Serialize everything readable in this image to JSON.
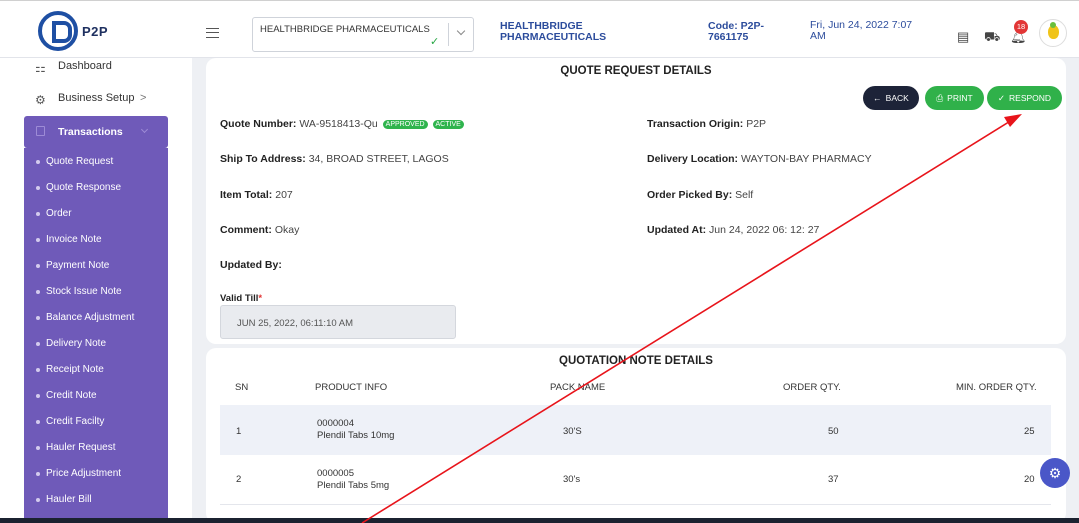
{
  "header": {
    "brand": "P2P",
    "company_select_value": "HEALTHBRIDGE PHARMACEUTICALS",
    "company_name": "HEALTHBRIDGE PHARMACEUTICALS",
    "code": "Code: P2P-7661175",
    "datetime": "Fri, Jun 24, 2022 7:07 AM",
    "notification_count": "18"
  },
  "sidebar": {
    "dashboard": "Dashboard",
    "business_setup": "Business Setup",
    "business_setup_chevron": ">",
    "transactions": "Transactions",
    "items": [
      "Quote Request",
      "Quote Response",
      "Order",
      "Invoice Note",
      "Payment Note",
      "Stock Issue Note",
      "Balance Adjustment",
      "Delivery Note",
      "Receipt Note",
      "Credit Note",
      "Credit Facilty",
      "Hauler Request",
      "Price Adjustment",
      "Hauler Bill"
    ]
  },
  "details": {
    "title": "QUOTE REQUEST DETAILS",
    "back_label": "BACK",
    "print_label": "PRINT",
    "respond_label": "RESPOND",
    "quote_number_label": "Quote Number:",
    "quote_number": "WA-9518413-Qu",
    "status_approved": "APPROVED",
    "status_active": "ACTIVE",
    "transaction_origin_label": "Transaction Origin:",
    "transaction_origin": "P2P",
    "ship_to_label": "Ship To Address:",
    "ship_to": "34, BROAD STREET, LAGOS",
    "delivery_location_label": "Delivery Location:",
    "delivery_location": "WAYTON-BAY PHARMACY",
    "item_total_label": "Item Total:",
    "item_total": "207",
    "order_picked_label": "Order Picked By:",
    "order_picked": "Self",
    "comment_label": "Comment:",
    "comment": "Okay",
    "updated_at_label": "Updated At:",
    "updated_at": "Jun 24, 2022 06: 12: 27",
    "updated_by_label": "Updated By:",
    "valid_till_label": "Valid Till",
    "valid_till_required": "*",
    "valid_till_value": "JUN 25, 2022, 06:11:10 AM"
  },
  "quotation": {
    "title": "QUOTATION NOTE DETAILS",
    "columns": [
      "SN",
      "PRODUCT INFO",
      "PACK NAME",
      "ORDER QTY.",
      "MIN. ORDER QTY."
    ],
    "rows": [
      {
        "sn": "1",
        "code": "0000004",
        "name": "Plendil Tabs 10mg",
        "pack": "30'S",
        "order_qty": "50",
        "min_qty": "25"
      },
      {
        "sn": "2",
        "code": "0000005",
        "name": "Plendil Tabs 5mg",
        "pack": "30's",
        "order_qty": "37",
        "min_qty": "20"
      }
    ]
  },
  "colors": {
    "accent": "#6f5ab9",
    "brand_blue": "#2c4c9c",
    "green": "#30b14a",
    "back_dark": "#1d2338",
    "annotation_arrow": "#e8141b"
  },
  "icons": {
    "dashboard": "grid-icon",
    "business_setup": "gear-icon",
    "transactions": "document-icon",
    "menu": "hamburger-icon",
    "notes": "list-icon",
    "cart": "cart-icon",
    "bell": "bell-icon",
    "settings_fab": "gear-icon"
  }
}
